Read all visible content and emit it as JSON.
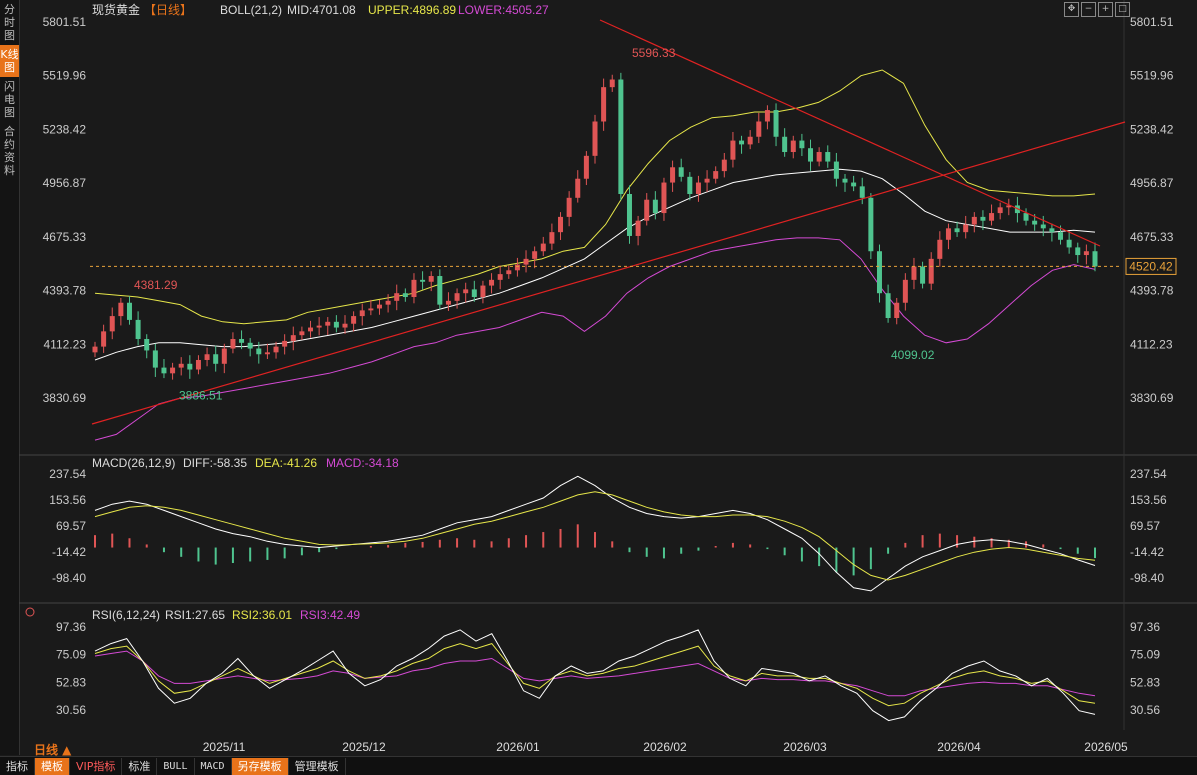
{
  "left_tabs": [
    "分时图",
    "K线图",
    "闪电图",
    "合约资料"
  ],
  "active_tab_index": 1,
  "header": {
    "symbol": "现货黄金",
    "period_tag": "【日线】",
    "boll_label": "BOLL(21,2)",
    "mid": "MID:4701.08",
    "upper": "UPPER:4896.89",
    "lower": "LOWER:4505.27"
  },
  "macd_header": {
    "name": "MACD(26,12,9)",
    "diff": "DIFF:-58.35",
    "dea": "DEA:-41.26",
    "macd": "MACD:-34.18"
  },
  "rsi_header": {
    "name": "RSI(6,12,24)",
    "rsi1": "RSI1:27.65",
    "rsi2": "RSI2:36.01",
    "rsi3": "RSI3:42.49"
  },
  "colors": {
    "up": "#e05555",
    "down": "#4fc48f",
    "mid": "#ffffff",
    "upper": "#e6e64a",
    "lower": "#d44ad4",
    "trend": "#e02222",
    "price_line": "#e8a23a",
    "macd_pos": "#e05555",
    "macd_neg": "#4fc48f"
  },
  "price_tag": "4520.42",
  "period_label": "日线 ▲",
  "bottom_tabs": [
    "指标",
    "模板",
    "VIP指标",
    "标准",
    "BULL",
    "MACD",
    "另存模板",
    "管理模板"
  ],
  "chart_data": [
    {
      "type": "candlestick",
      "title": "现货黄金【日线】",
      "y_ticks": [
        "5801.51",
        "5519.96",
        "5238.42",
        "4956.87",
        "4675.33",
        "4393.78",
        "4112.23",
        "3830.69"
      ],
      "ylim": [
        3830.69,
        5801.51
      ],
      "x_ticks": [
        "2025/11",
        "2025/12",
        "2026/01",
        "2026/02",
        "2026/03",
        "2026/04",
        "2026/05"
      ],
      "annotations": [
        {
          "text": "4381.29",
          "value": 4381.29,
          "kind": "high"
        },
        {
          "text": "3886.51",
          "value": 3886.51,
          "kind": "low"
        },
        {
          "text": "5596.33",
          "value": 5596.33,
          "kind": "high"
        },
        {
          "text": "4099.02",
          "value": 4099.02,
          "kind": "low"
        }
      ],
      "current_price": 4520.42,
      "closes": [
        4100,
        4180,
        4260,
        4330,
        4240,
        4140,
        4080,
        3990,
        3960,
        3990,
        4010,
        3980,
        4030,
        4060,
        4010,
        4090,
        4140,
        4120,
        4090,
        4060,
        4070,
        4100,
        4130,
        4160,
        4180,
        4200,
        4210,
        4230,
        4200,
        4220,
        4260,
        4290,
        4300,
        4320,
        4340,
        4380,
        4360,
        4450,
        4440,
        4470,
        4320,
        4340,
        4380,
        4400,
        4360,
        4420,
        4450,
        4480,
        4500,
        4530,
        4560,
        4600,
        4640,
        4700,
        4780,
        4880,
        4980,
        5100,
        5280,
        5460,
        5500,
        4900,
        4680,
        4760,
        4870,
        4800,
        4960,
        5040,
        4990,
        4900,
        4960,
        4980,
        5020,
        5080,
        5180,
        5160,
        5200,
        5280,
        5340,
        5200,
        5120,
        5180,
        5140,
        5070,
        5120,
        5070,
        4980,
        4960,
        4940,
        4880,
        4600,
        4380,
        4250,
        4330,
        4450,
        4520,
        4430,
        4560,
        4660,
        4720,
        4700,
        4740,
        4780,
        4760,
        4800,
        4830,
        4840,
        4800,
        4760,
        4740,
        4720,
        4700,
        4660,
        4620,
        4580,
        4600,
        4520
      ],
      "upper_band": [
        4380,
        4370,
        4360,
        4340,
        4320,
        4260,
        4230,
        4220,
        4230,
        4240,
        4280,
        4300,
        4320,
        4340,
        4360,
        4380,
        4420,
        4450,
        4480,
        4520,
        4540,
        4560,
        4600,
        4620,
        4740,
        4920,
        5060,
        5180,
        5250,
        5300,
        5310,
        5330,
        5330,
        5350,
        5380,
        5440,
        5520,
        5550,
        5480,
        5260,
        5080,
        4960,
        4920,
        4910,
        4900,
        4890,
        4890,
        4900
      ],
      "mid_band": [
        4030,
        4070,
        4100,
        4120,
        4120,
        4110,
        4100,
        4100,
        4110,
        4120,
        4140,
        4160,
        4180,
        4200,
        4230,
        4260,
        4290,
        4320,
        4350,
        4380,
        4420,
        4460,
        4510,
        4560,
        4640,
        4720,
        4780,
        4830,
        4880,
        4920,
        4960,
        4980,
        5000,
        5010,
        5020,
        5030,
        5020,
        4980,
        4900,
        4810,
        4760,
        4740,
        4720,
        4700,
        4700,
        4700,
        4710,
        4700
      ],
      "lower_band": [
        3610,
        3640,
        3720,
        3800,
        3830,
        3840,
        3860,
        3880,
        3900,
        3920,
        3940,
        3960,
        3990,
        4020,
        4060,
        4100,
        4120,
        4160,
        4180,
        4200,
        4240,
        4280,
        4260,
        4180,
        4260,
        4380,
        4460,
        4520,
        4560,
        4600,
        4620,
        4640,
        4660,
        4670,
        4670,
        4660,
        4560,
        4400,
        4260,
        4160,
        4120,
        4140,
        4220,
        4320,
        4420,
        4500,
        4530,
        4505
      ]
    },
    {
      "type": "bar+line",
      "title": "MACD(26,12,9)",
      "y_ticks": [
        "237.54",
        "153.56",
        "69.57",
        "-14.42",
        "-98.40"
      ],
      "ylim": [
        -98.4,
        237.54
      ],
      "diff": [
        120,
        140,
        150,
        140,
        120,
        100,
        80,
        60,
        45,
        35,
        20,
        10,
        5,
        0,
        5,
        10,
        15,
        20,
        30,
        40,
        60,
        80,
        90,
        100,
        120,
        140,
        160,
        200,
        230,
        200,
        160,
        130,
        110,
        100,
        95,
        100,
        110,
        120,
        110,
        90,
        60,
        30,
        -20,
        -80,
        -130,
        -140,
        -100,
        -60,
        -30,
        -10,
        10,
        20,
        25,
        20,
        10,
        -5,
        -20,
        -40,
        -58
      ],
      "dea": [
        100,
        115,
        130,
        135,
        130,
        120,
        105,
        90,
        75,
        60,
        45,
        30,
        20,
        10,
        8,
        10,
        12,
        15,
        20,
        30,
        45,
        60,
        75,
        85,
        100,
        115,
        130,
        150,
        170,
        180,
        170,
        150,
        130,
        115,
        105,
        100,
        100,
        105,
        105,
        100,
        85,
        65,
        35,
        -10,
        -55,
        -90,
        -105,
        -90,
        -70,
        -50,
        -30,
        -15,
        -5,
        0,
        -5,
        -15,
        -25,
        -35,
        -41
      ],
      "hist": [
        40,
        45,
        30,
        10,
        -15,
        -30,
        -45,
        -55,
        -50,
        -45,
        -40,
        -35,
        -25,
        -15,
        -5,
        0,
        5,
        8,
        15,
        18,
        25,
        30,
        25,
        20,
        30,
        40,
        50,
        60,
        75,
        50,
        20,
        -15,
        -30,
        -35,
        -20,
        -10,
        5,
        15,
        10,
        -5,
        -25,
        -45,
        -60,
        -80,
        -90,
        -70,
        -20,
        15,
        40,
        45,
        40,
        35,
        30,
        25,
        20,
        10,
        -5,
        -20,
        -34
      ]
    },
    {
      "type": "line",
      "title": "RSI(6,12,24)",
      "y_ticks": [
        "97.36",
        "75.09",
        "52.83",
        "30.56"
      ],
      "ylim": [
        30.56,
        97.36
      ],
      "rsi1": [
        78,
        84,
        88,
        70,
        48,
        36,
        40,
        52,
        60,
        72,
        58,
        48,
        55,
        62,
        70,
        78,
        60,
        50,
        55,
        66,
        72,
        80,
        90,
        95,
        86,
        92,
        70,
        46,
        40,
        58,
        66,
        60,
        62,
        70,
        74,
        80,
        86,
        90,
        95,
        70,
        56,
        50,
        64,
        62,
        60,
        54,
        58,
        50,
        44,
        30,
        22,
        25,
        38,
        48,
        60,
        66,
        70,
        62,
        58,
        50,
        56,
        44,
        30,
        27
      ],
      "rsi2": [
        76,
        80,
        82,
        70,
        54,
        44,
        46,
        52,
        58,
        64,
        58,
        52,
        56,
        60,
        64,
        70,
        62,
        56,
        58,
        62,
        68,
        72,
        80,
        84,
        80,
        84,
        68,
        52,
        48,
        58,
        62,
        58,
        60,
        64,
        66,
        70,
        74,
        78,
        82,
        66,
        58,
        54,
        60,
        58,
        58,
        56,
        56,
        52,
        48,
        40,
        34,
        36,
        44,
        50,
        56,
        60,
        62,
        58,
        56,
        52,
        54,
        46,
        38,
        36
      ],
      "rsi3": [
        74,
        76,
        78,
        70,
        58,
        52,
        52,
        54,
        56,
        58,
        56,
        54,
        55,
        56,
        58,
        62,
        60,
        56,
        57,
        58,
        62,
        64,
        68,
        70,
        70,
        72,
        64,
        56,
        54,
        56,
        58,
        56,
        57,
        58,
        60,
        62,
        64,
        66,
        68,
        62,
        56,
        54,
        56,
        55,
        55,
        54,
        54,
        52,
        50,
        46,
        42,
        42,
        46,
        48,
        50,
        52,
        53,
        52,
        52,
        50,
        50,
        47,
        44,
        42
      ]
    }
  ]
}
